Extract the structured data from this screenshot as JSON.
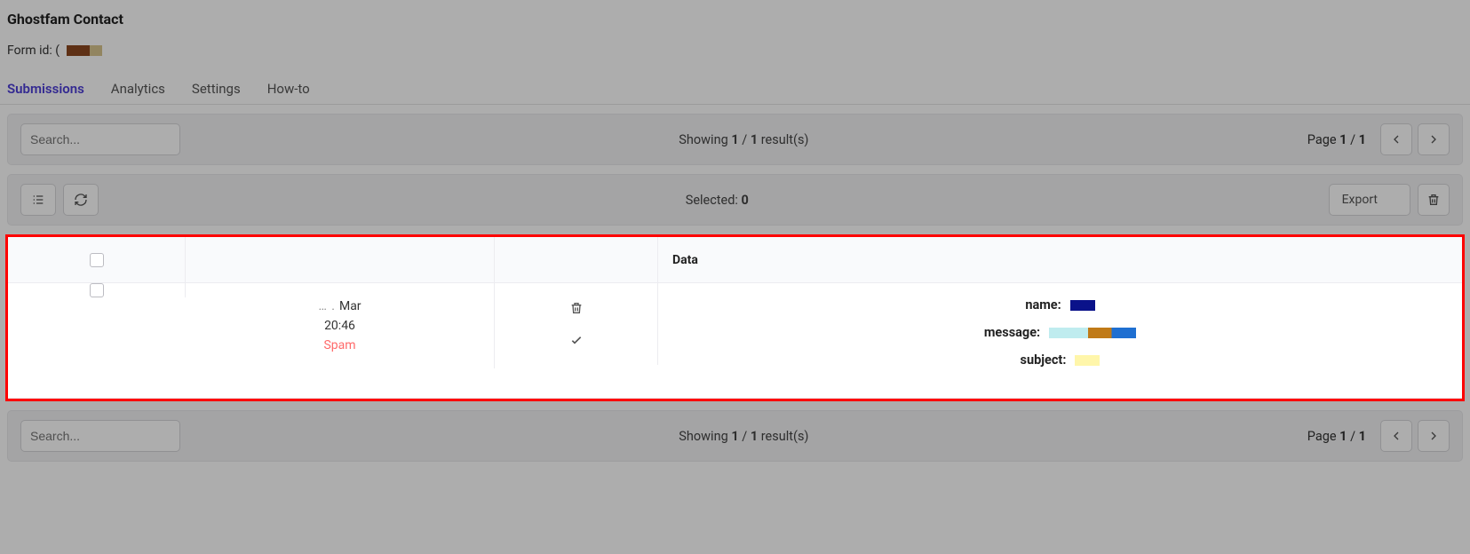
{
  "header": {
    "title": "Ghostfam Contact",
    "form_id_label": "Form id: ("
  },
  "tabs": {
    "submissions": "Submissions",
    "analytics": "Analytics",
    "settings": "Settings",
    "howto": "How-to"
  },
  "toolbar_top": {
    "search_placeholder": "Search...",
    "showing_prefix": "Showing ",
    "showing_current": "1",
    "showing_sep": " / ",
    "showing_total": "1",
    "showing_suffix": " result(s)",
    "page_prefix": "Page ",
    "page_current": "1",
    "page_sep": " / ",
    "page_total": "1"
  },
  "toolbar_mid": {
    "selected_label": "Selected: ",
    "selected_count": "0",
    "export_label": "Export"
  },
  "table": {
    "header_data": "Data",
    "row": {
      "date_prefix": "… .",
      "date_month": "Mar",
      "time": "20:46",
      "spam_label": "Spam",
      "fields": {
        "name_key": "name:",
        "message_key": "message:",
        "subject_key": "subject:"
      }
    }
  },
  "toolbar_bottom": {
    "search_placeholder": "Search...",
    "showing_prefix": "Showing ",
    "showing_current": "1",
    "showing_sep": " / ",
    "showing_total": "1",
    "showing_suffix": " result(s)",
    "page_prefix": "Page ",
    "page_current": "1",
    "page_sep": " / ",
    "page_total": "1"
  }
}
